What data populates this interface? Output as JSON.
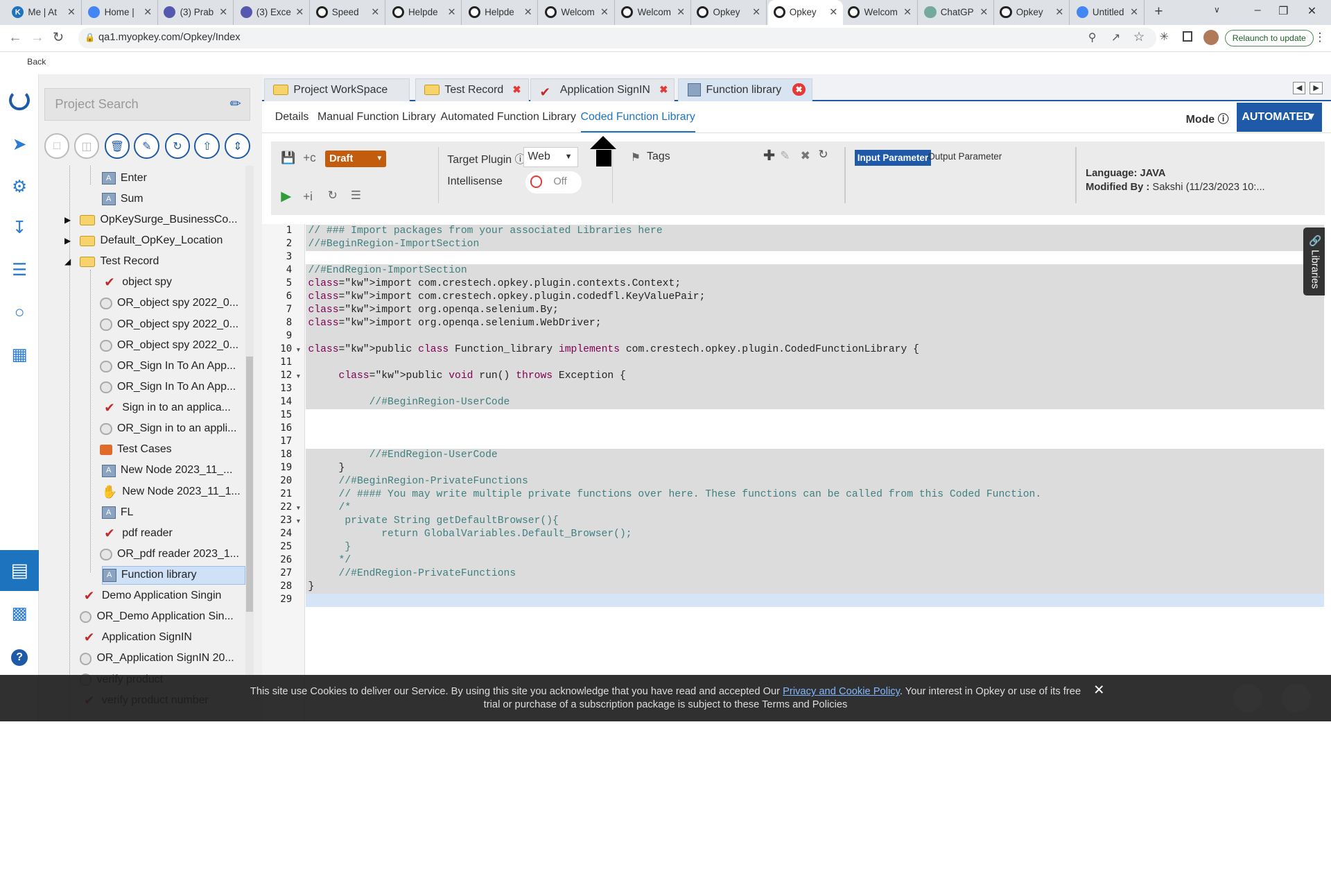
{
  "browser": {
    "tabs": [
      {
        "label": "Me | At",
        "icon": "k"
      },
      {
        "label": "Home |",
        "icon": "gear"
      },
      {
        "label": "(3) Prab",
        "icon": "teams"
      },
      {
        "label": "(3) Exce",
        "icon": "teams"
      },
      {
        "label": "Speed",
        "icon": "ring"
      },
      {
        "label": "Helpde",
        "icon": "ring"
      },
      {
        "label": "Helpde",
        "icon": "ring"
      },
      {
        "label": "Welcom",
        "icon": "ring"
      },
      {
        "label": "Welcom",
        "icon": "ring"
      },
      {
        "label": "Opkey",
        "icon": "ring"
      },
      {
        "label": "Opkey",
        "icon": "ring"
      },
      {
        "label": "Welcom",
        "icon": "ring"
      },
      {
        "label": "ChatGP",
        "icon": "chatgpt"
      },
      {
        "label": "Opkey",
        "icon": "ring"
      },
      {
        "label": "Untitled",
        "icon": "doc"
      }
    ],
    "url": "qa1.myopkey.com/Opkey/Index",
    "relaunch": "Relaunch to update",
    "back": "Back"
  },
  "tree": {
    "search_placeholder": "Project Search",
    "nodes": [
      {
        "label": "Enter",
        "icon": "lib",
        "indent": 2
      },
      {
        "label": "Sum",
        "icon": "lib",
        "indent": 2
      },
      {
        "label": "OpKeySurge_BusinessCo...",
        "icon": "folder",
        "indent": 1,
        "expand": "closed"
      },
      {
        "label": "Default_OpKey_Location",
        "icon": "folder",
        "indent": 1,
        "expand": "closed"
      },
      {
        "label": "Test Record",
        "icon": "folder",
        "indent": 1,
        "expand": "open"
      },
      {
        "label": "object spy",
        "icon": "red",
        "indent": 2
      },
      {
        "label": "OR_object spy 2022_0...",
        "icon": "gear",
        "indent": 2
      },
      {
        "label": "OR_object spy 2022_0...",
        "icon": "gear",
        "indent": 2
      },
      {
        "label": "OR_object spy 2022_0...",
        "icon": "gear",
        "indent": 2
      },
      {
        "label": "OR_Sign In To An App...",
        "icon": "gear",
        "indent": 2
      },
      {
        "label": "OR_Sign In To An App...",
        "icon": "gear",
        "indent": 2
      },
      {
        "label": "Sign in to an applica...",
        "icon": "red",
        "indent": 2
      },
      {
        "label": "OR_Sign in to an appli...",
        "icon": "gear",
        "indent": 2
      },
      {
        "label": "Test Cases",
        "icon": "case",
        "indent": 2
      },
      {
        "label": "New Node 2023_11_...",
        "icon": "lib",
        "indent": 2
      },
      {
        "label": "New Node 2023_11_1...",
        "icon": "hand",
        "indent": 2
      },
      {
        "label": "FL",
        "icon": "lib",
        "indent": 2
      },
      {
        "label": "pdf reader",
        "icon": "red",
        "indent": 2
      },
      {
        "label": "OR_pdf reader 2023_1...",
        "icon": "gear",
        "indent": 2
      },
      {
        "label": "Function library",
        "icon": "lib",
        "indent": 2,
        "selected": true
      },
      {
        "label": "Demo Application Singin",
        "icon": "red",
        "indent": 1
      },
      {
        "label": "OR_Demo Application Sin...",
        "icon": "gear",
        "indent": 1
      },
      {
        "label": "Application SignIN",
        "icon": "red",
        "indent": 1
      },
      {
        "label": "OR_Application SignIN 20...",
        "icon": "gear",
        "indent": 1
      },
      {
        "label": "verify product",
        "icon": "gear",
        "indent": 1
      },
      {
        "label": "verify product number",
        "icon": "red",
        "indent": 1
      }
    ]
  },
  "main": {
    "tabs": [
      {
        "label": "Project WorkSpace"
      },
      {
        "label": "Test Record"
      },
      {
        "label": "Application SignIN"
      },
      {
        "label": "Function library"
      }
    ],
    "subtabs": [
      "Details",
      "Manual Function Library",
      "Automated Function Library",
      "Coded Function Library"
    ],
    "mode_label": "Mode",
    "mode_value": "AUTOMATED",
    "toolbar": {
      "status": "Draft",
      "target_plugin_label": "Target Plugin",
      "target_plugin_value": "Web",
      "intellisense_label": "Intellisense",
      "intellisense_value": "Off",
      "tags_label": "Tags",
      "input_param": "Input Parameter",
      "output_param": "Output Parameter",
      "language_label": "Language:",
      "language_value": "JAVA",
      "modified_label": "Modified By :",
      "modified_value": "Sakshi (11/23/2023 10:..."
    },
    "libraries_tab": "Libraries"
  },
  "code": [
    "// ### Import packages from your associated Libraries here",
    "//#BeginRegion-ImportSection",
    "",
    "//#EndRegion-ImportSection",
    "import com.crestech.opkey.plugin.contexts.Context;",
    "import com.crestech.opkey.plugin.codedfl.KeyValuePair;",
    "import org.openqa.selenium.By;",
    "import org.openqa.selenium.WebDriver;",
    "",
    "public class Function_library implements com.crestech.opkey.plugin.CodedFunctionLibrary {",
    "",
    "     public void run() throws Exception {",
    "",
    "          //#BeginRegion-UserCode",
    "",
    "",
    "",
    "          //#EndRegion-UserCode",
    "     }",
    "     //#BeginRegion-PrivateFunctions",
    "     // #### You may write multiple private functions over here. These functions can be called from this Coded Function.",
    "     /*",
    "      private String getDefaultBrowser(){",
    "            return GlobalVariables.Default_Browser();",
    "      }",
    "     */",
    "     //#EndRegion-PrivateFunctions",
    "}",
    ""
  ],
  "cookie": {
    "text1": "This site use Cookies to deliver our Service. By using this site you acknowledge that you have read and accepted Our ",
    "link": "Privacy and Cookie Policy",
    "text2": ". Your interest in Opkey or use of its free",
    "text3": "trial or purchase of a subscription package is subject to these Terms and Policies"
  }
}
